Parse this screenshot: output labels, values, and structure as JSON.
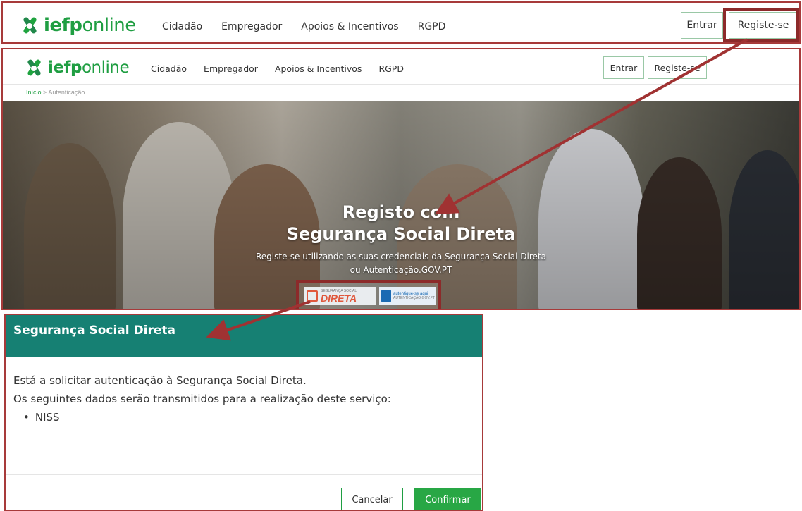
{
  "brand": {
    "part1": "iefp",
    "part2": "online"
  },
  "nav": [
    "Cidadão",
    "Empregador",
    "Apoios & Incentivos",
    "RGPD"
  ],
  "auth": {
    "entrar": "Entrar",
    "registe": "Registe-se"
  },
  "breadcrumb": {
    "home": "Início",
    "separator": ">",
    "current": "Autenticação"
  },
  "hero": {
    "title_line1": "Registo com",
    "title_line2": "Segurança Social Direta",
    "subtitle_line1": "Registe-se utilizando as suas credenciais da Segurança Social Direta",
    "subtitle_line2": "ou Autenticação.GOV.PT",
    "ssd_logo_small": "SEGURANÇA SOCIAL",
    "ssd_logo_big": "DIRETA",
    "gov_logo_line1": "autentique-se aqui",
    "gov_logo_line2": "AUTENTICAÇÃO.GOV.PT"
  },
  "dialog": {
    "title": "Segurança Social Direta",
    "line1": "Está a solicitar autenticação à Segurança Social Direta.",
    "line2": "Os seguintes dados serão transmitidos para a realização deste serviço:",
    "items": [
      "NISS"
    ],
    "cancel": "Cancelar",
    "confirm": "Confirmar"
  },
  "colors": {
    "brand_green": "#1f9e42",
    "dialog_header": "#168073",
    "annotation": "#8c2a2a",
    "confirm_button": "#28a745"
  }
}
